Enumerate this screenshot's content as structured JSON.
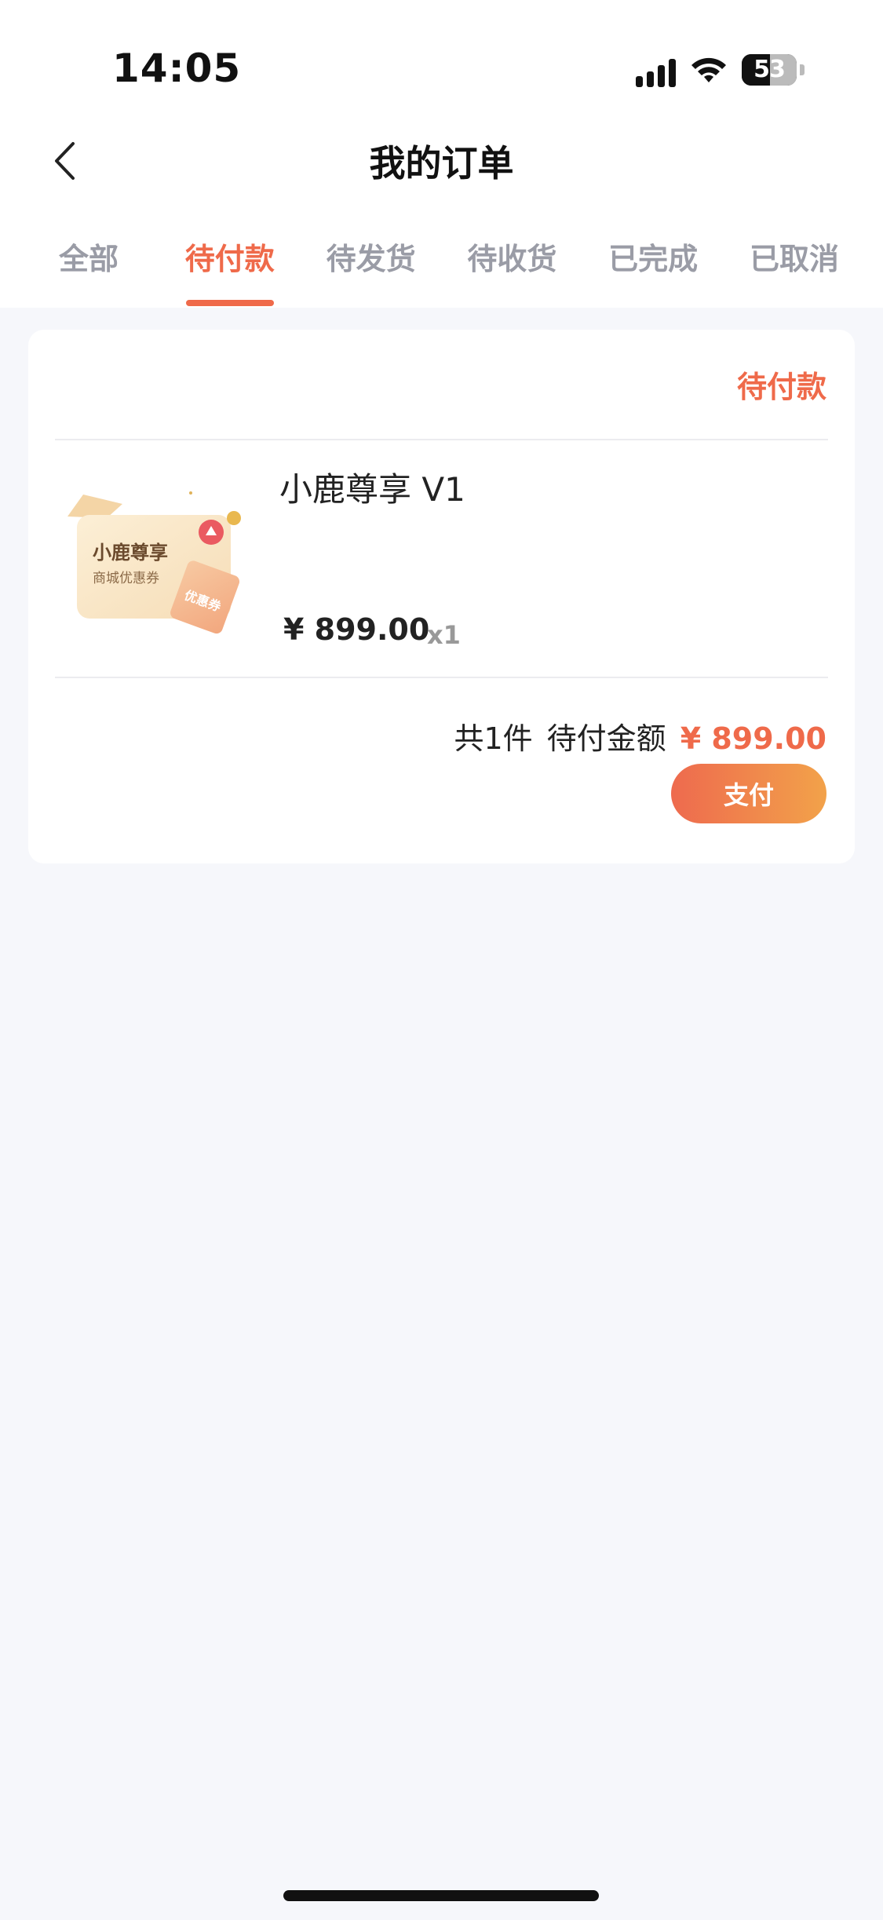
{
  "status_bar": {
    "time": "14:05",
    "battery": "53"
  },
  "nav": {
    "title": "我的订单"
  },
  "tabs": [
    {
      "label": "全部"
    },
    {
      "label": "待付款",
      "active": true
    },
    {
      "label": "待发货"
    },
    {
      "label": "待收货"
    },
    {
      "label": "已完成"
    },
    {
      "label": "已取消"
    }
  ],
  "order": {
    "status": "待付款",
    "product": {
      "name": "小鹿尊享 V1",
      "image_title": "小鹿尊享",
      "image_subtitle": "商城优惠券",
      "price": "¥ 899.00",
      "quantity": "x1"
    },
    "summary_count": "共1件",
    "summary_label": "待付金额",
    "summary_amount": "¥ 899.00",
    "pay_label": "支付"
  },
  "colors": {
    "accent": "#ef6a4a",
    "tab_inactive": "#9a9ca6",
    "page_bg": "#f6f7fb"
  }
}
